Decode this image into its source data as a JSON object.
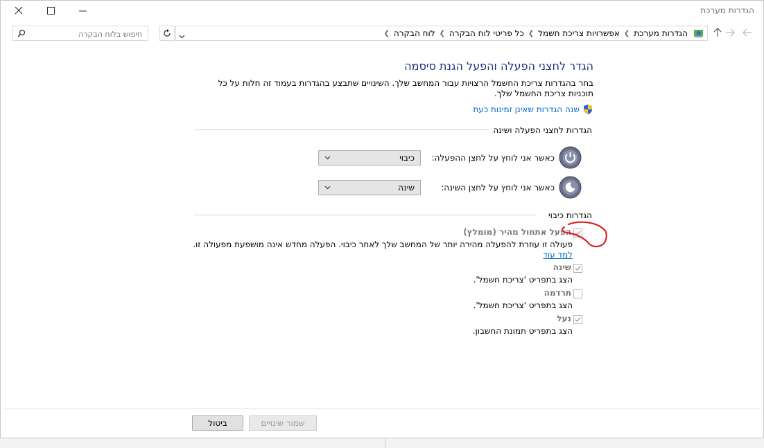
{
  "window": {
    "title": "הגדרות מערכת",
    "minimize_icon": "minimize-icon",
    "maximize_icon": "maximize-icon",
    "close_icon": "close-icon"
  },
  "address": {
    "breadcrumb": [
      "לוח הבקרה",
      "כל פריטי לוח הבקרה",
      "אפשרויות צריכת חשמל",
      "הגדרות מערכת"
    ]
  },
  "search": {
    "placeholder": "חיפוש בלוח הבקרה"
  },
  "main": {
    "heading": "הגדר לחצני הפעלה והפעל הגנת סיסמה",
    "description": "בחר בהגדרות צריכת החשמל הרצויות עבור המחשב שלך. השינויים שתבצע בהגדרות בעמוד זה חלות על כל תוכניות צריכת החשמל שלך.",
    "change_unavailable_link": "שנה הגדרות שאינן זמינות כעת"
  },
  "buttons_section": {
    "title": "הגדרות לחצני הפעלה ושינה",
    "power_label": "כאשר אני לוחץ על לחצן ההפעלה:",
    "power_value": "כיבוי",
    "sleep_label": "כאשר אני לוחץ על לחצן השינה:",
    "sleep_value": "שינה"
  },
  "shutdown_section": {
    "title": "הגדרות כיבוי",
    "fast_startup_label": "הפעל אתחול מהיר (מומלץ)",
    "fast_startup_desc": "פעולה זו עוזרת להפעלה מהירה יותר של המחשב שלך לאחר כיבוי. הפעלה מחדש אינה מושפעת מפעולה זו.",
    "learn_more": "למד עוד",
    "sleep_label": "שינה",
    "sleep_desc": "הצג בתפריט 'צריכת חשמל'.",
    "hibernate_label": "תרדמה",
    "hibernate_desc": "הצג בתפריט 'צריכת חשמל'.",
    "lock_label": "נעל",
    "lock_desc": "הצג בתפריט תמונת החשבון.",
    "checked": {
      "fast_startup": true,
      "sleep": true,
      "hibernate": false,
      "lock": true
    }
  },
  "footer": {
    "save_label": "שמור שינויים",
    "cancel_label": "ביטול"
  },
  "colors": {
    "heading": "#1e3287",
    "link": "#0066cc",
    "annotation": "#e02020"
  }
}
